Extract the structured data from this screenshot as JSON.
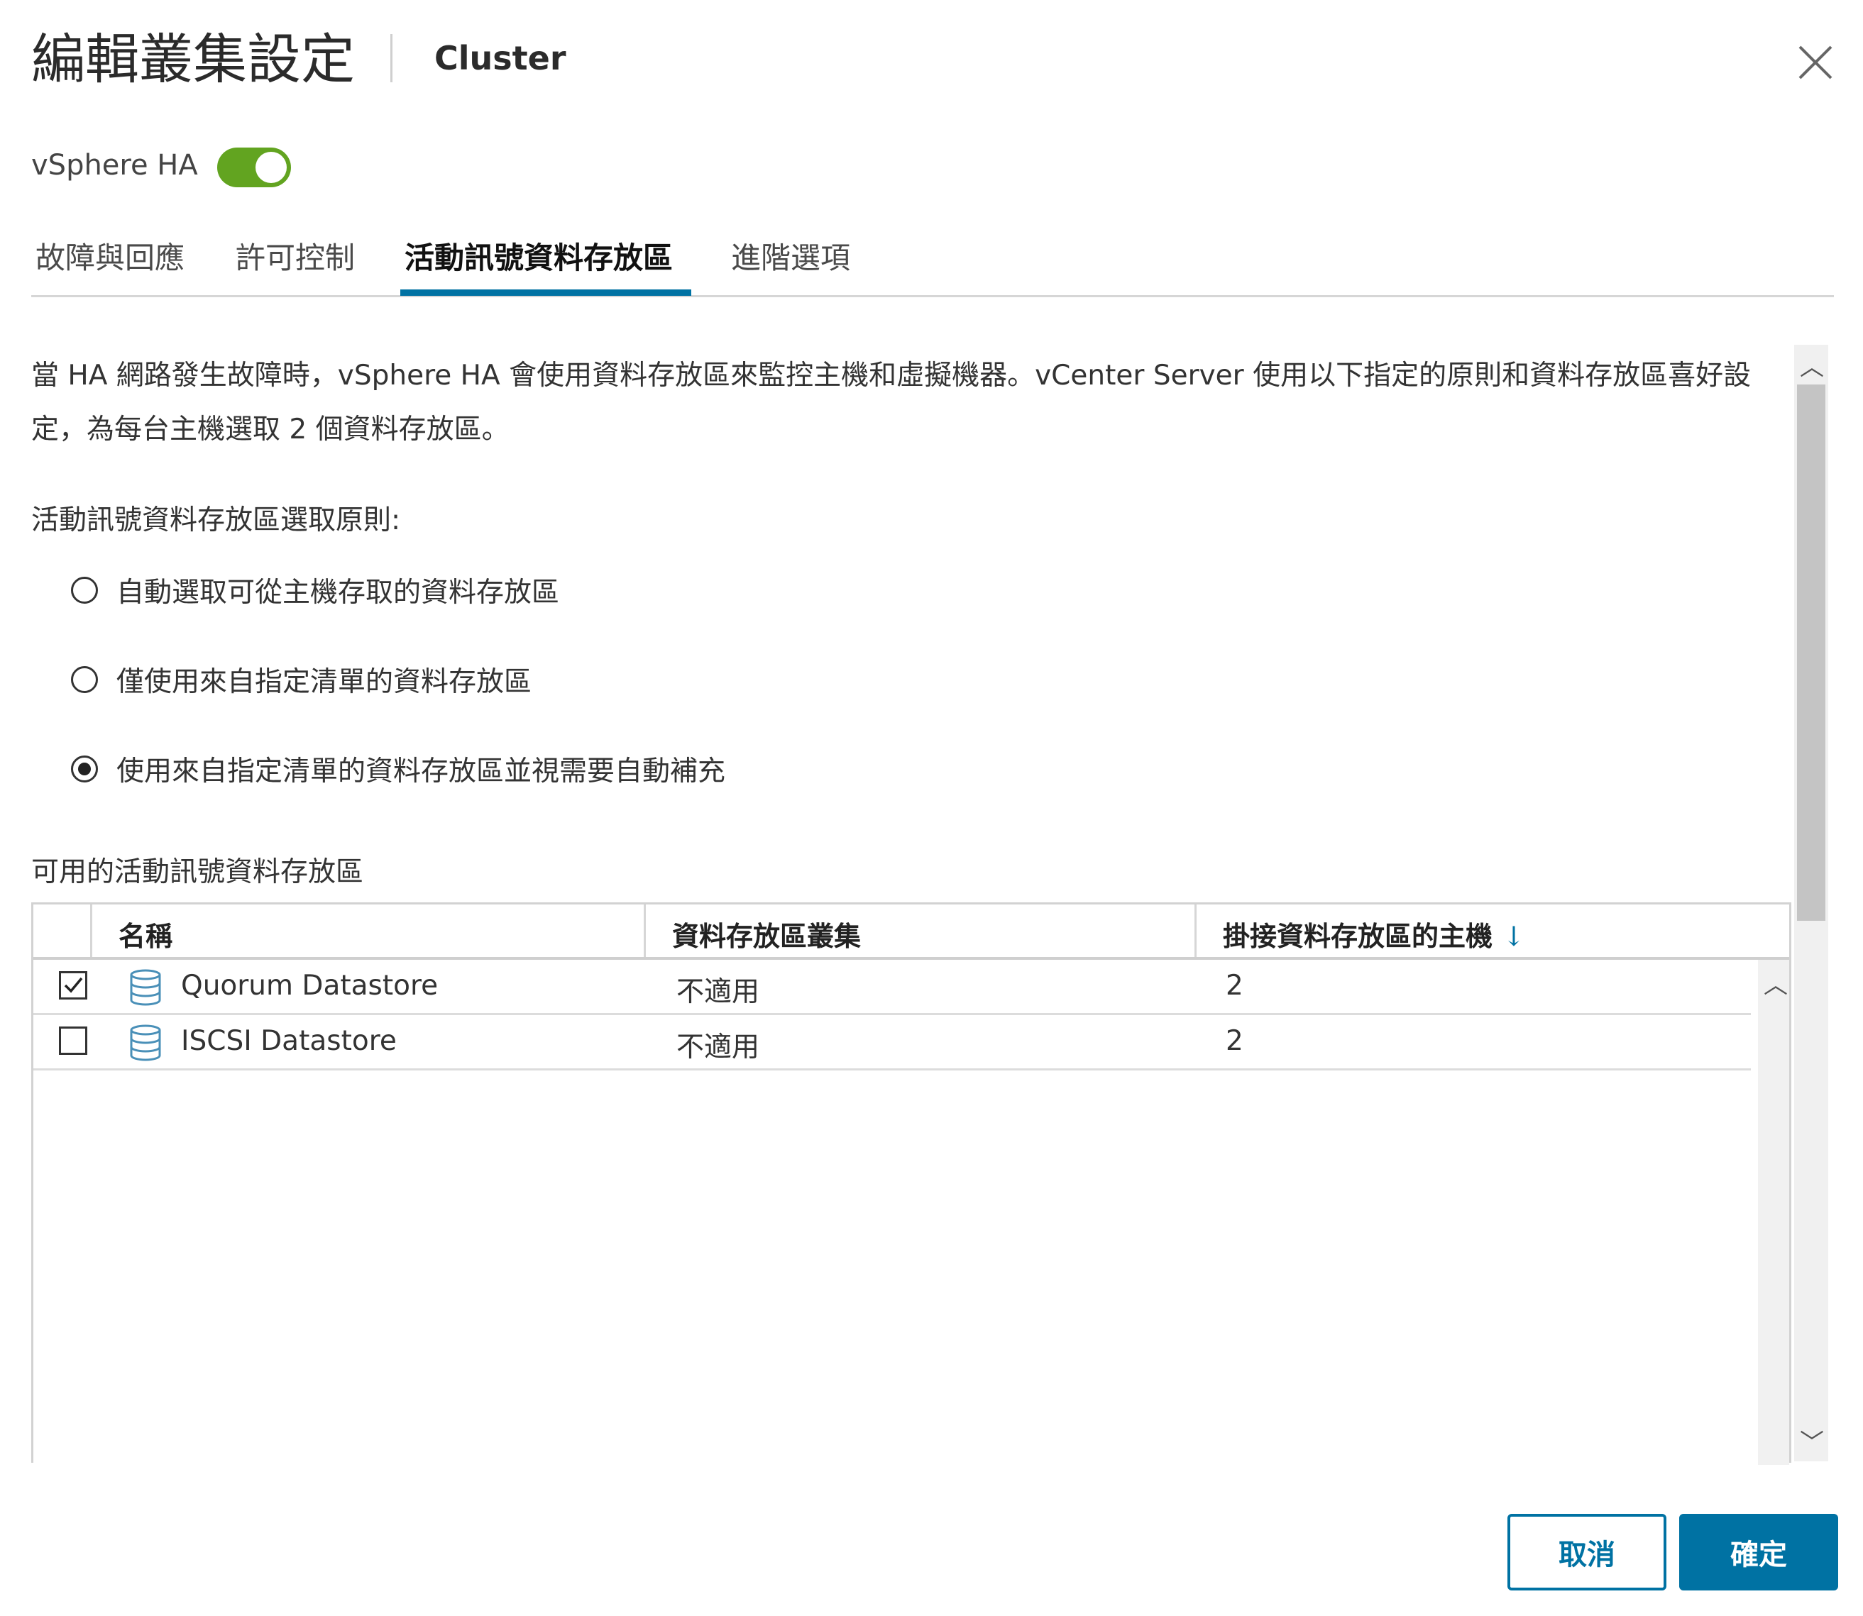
{
  "dialog": {
    "title": "編輯叢集設定",
    "subtitle": "Cluster"
  },
  "ha": {
    "label": "vSphere HA",
    "enabled": true
  },
  "tabs": [
    {
      "label": "故障與回應",
      "active": false
    },
    {
      "label": "許可控制",
      "active": false
    },
    {
      "label": "活動訊號資料存放區",
      "active": true
    },
    {
      "label": "進階選項",
      "active": false
    }
  ],
  "description": "當 HA 網路發生故障時，vSphere HA 會使用資料存放區來監控主機和虛擬機器。vCenter Server 使用以下指定的原則和資料存放區喜好設定，為每台主機選取 2 個資料存放區。",
  "policy": {
    "label": "活動訊號資料存放區選取原則:",
    "options": [
      {
        "label": "自動選取可從主機存取的資料存放區",
        "selected": false
      },
      {
        "label": "僅使用來自指定清單的資料存放區",
        "selected": false
      },
      {
        "label": "使用來自指定清單的資料存放區並視需要自動補充",
        "selected": true
      }
    ]
  },
  "datastores": {
    "label": "可用的活動訊號資料存放區",
    "columns": {
      "name": "名稱",
      "cluster": "資料存放區叢集",
      "hosts": "掛接資料存放區的主機",
      "sort_icon": "sort-down-arrow-icon"
    },
    "rows": [
      {
        "checked": true,
        "name": "Quorum Datastore",
        "cluster": "不適用",
        "hosts": "2"
      },
      {
        "checked": false,
        "name": "ISCSI Datastore",
        "cluster": "不適用",
        "hosts": "2"
      }
    ]
  },
  "buttons": {
    "cancel": "取消",
    "ok": "確定"
  },
  "colors": {
    "accent": "#0072a3",
    "toggle_on": "#62a420"
  }
}
